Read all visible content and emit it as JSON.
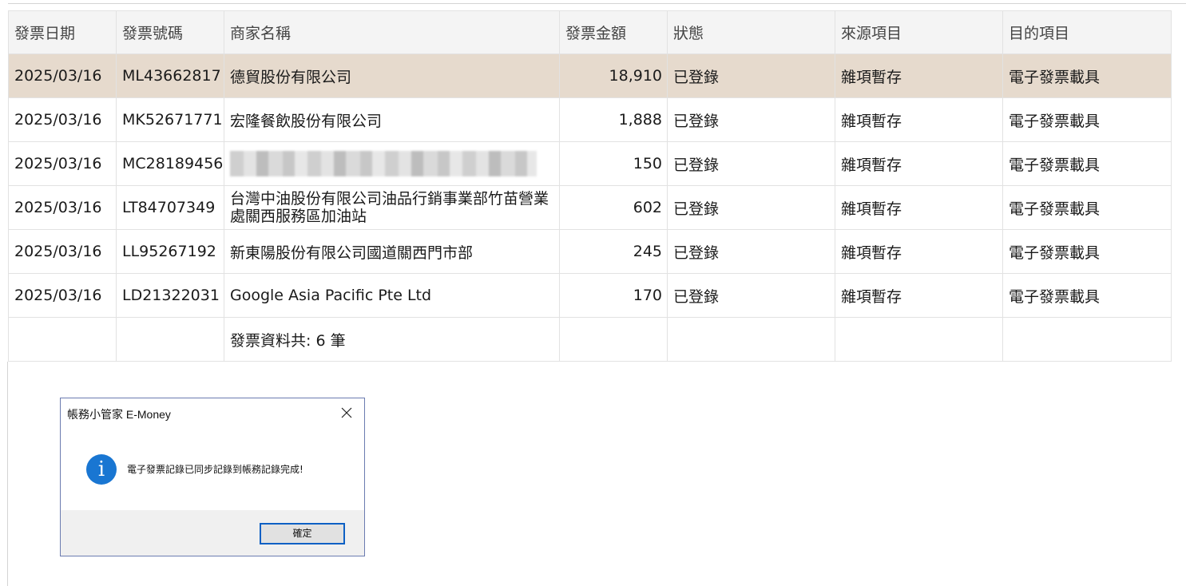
{
  "table": {
    "headers": [
      "發票日期",
      "發票號碼",
      "商家名稱",
      "發票金額",
      "狀態",
      "來源項目",
      "目的項目"
    ],
    "rows": [
      {
        "date": "2025/03/16",
        "number": "ML43662817",
        "merchant": "德貿股份有限公司",
        "amount": "18,910",
        "status": "已登錄",
        "source": "雜項暫存",
        "target": "電子發票載具"
      },
      {
        "date": "2025/03/16",
        "number": "MK52671771",
        "merchant": "宏隆餐飲股份有限公司",
        "amount": "1,888",
        "status": "已登錄",
        "source": "雜項暫存",
        "target": "電子發票載具"
      },
      {
        "date": "2025/03/16",
        "number": "MC28189456",
        "merchant": "",
        "amount": "150",
        "status": "已登錄",
        "source": "雜項暫存",
        "target": "電子發票載具"
      },
      {
        "date": "2025/03/16",
        "number": "LT84707349",
        "merchant": "台灣中油股份有限公司油品行銷事業部竹苗營業處關西服務區加油站",
        "amount": "602",
        "status": "已登錄",
        "source": "雜項暫存",
        "target": "電子發票載具"
      },
      {
        "date": "2025/03/16",
        "number": "LL95267192",
        "merchant": "新東陽股份有限公司國道關西門市部",
        "amount": "245",
        "status": "已登錄",
        "source": "雜項暫存",
        "target": "電子發票載具"
      },
      {
        "date": "2025/03/16",
        "number": "LD21322031",
        "merchant": "Google Asia Pacific Pte Ltd",
        "amount": "170",
        "status": "已登錄",
        "source": "雜項暫存",
        "target": "電子發票載具"
      }
    ],
    "summary": "發票資料共: 6 筆",
    "selected_row_color": "#e6dacd"
  },
  "dialog": {
    "title": "帳務小管家 E-Money",
    "close_icon": "close-icon",
    "info_icon": "information-icon",
    "info_glyph": "i",
    "message": "電子發票記錄已同步記錄到帳務記錄完成!",
    "ok_label": "確定",
    "accent_color": "#1976d2"
  }
}
